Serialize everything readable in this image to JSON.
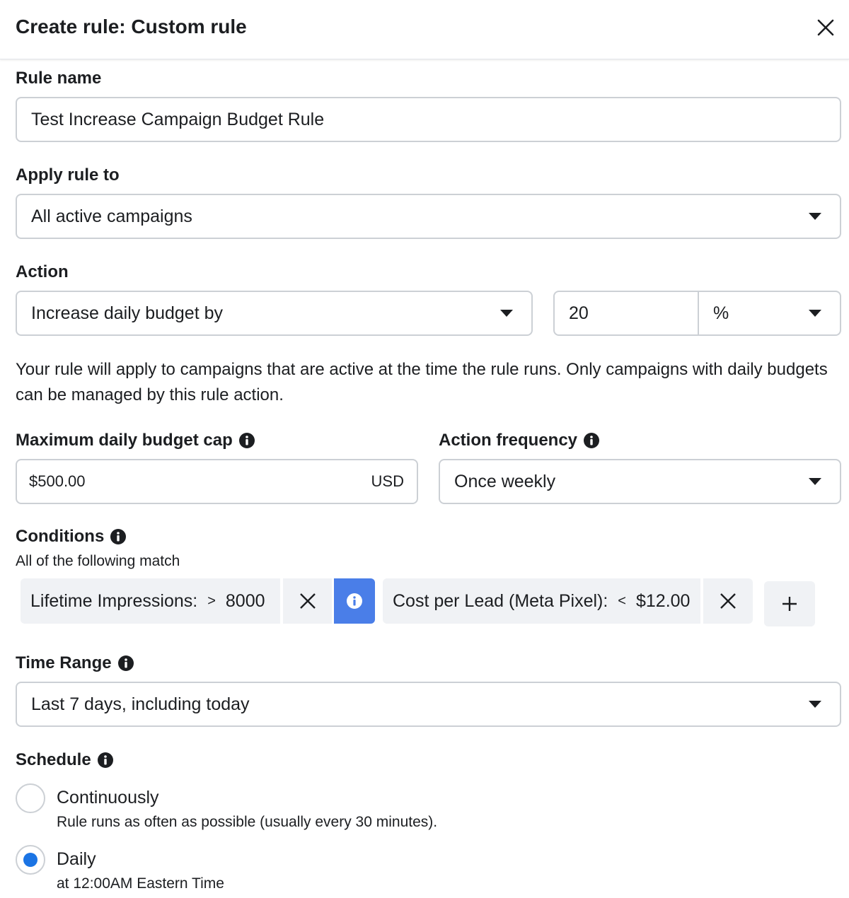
{
  "dialog": {
    "title": "Create rule: Custom rule",
    "close_icon": "close-icon"
  },
  "rule_name": {
    "label": "Rule name",
    "value": "Test Increase Campaign Budget Rule"
  },
  "apply_rule_to": {
    "label": "Apply rule to",
    "value": "All active campaigns"
  },
  "action": {
    "label": "Action",
    "type_value": "Increase daily budget by",
    "amount_value": "20",
    "unit_value": "%",
    "description": "Your rule will apply to campaigns that are active at the time the rule runs. Only campaigns with daily budgets can be managed by this rule action."
  },
  "budget_cap": {
    "label": "Maximum daily budget cap",
    "value": "$500.00",
    "currency": "USD"
  },
  "action_frequency": {
    "label": "Action frequency",
    "value": "Once weekly"
  },
  "conditions": {
    "label": "Conditions",
    "subtitle": "All of the following match",
    "items": [
      {
        "metric": "Lifetime Impressions:",
        "operator": ">",
        "value": "8000"
      },
      {
        "metric": "Cost per Lead (Meta Pixel):",
        "operator": "<",
        "value": "$12.00"
      }
    ]
  },
  "time_range": {
    "label": "Time Range",
    "value": "Last 7 days, including today"
  },
  "schedule": {
    "label": "Schedule",
    "options": [
      {
        "label": "Continuously",
        "description": "Rule runs as often as possible (usually every 30 minutes).",
        "selected": false
      },
      {
        "label": "Daily",
        "description": "at 12:00AM Eastern Time",
        "selected": true
      }
    ]
  },
  "colors": {
    "accent": "#1b74e4",
    "info_chip": "#4a7ee8",
    "chip_bg": "#f0f2f5",
    "border": "#ccd0d5"
  }
}
